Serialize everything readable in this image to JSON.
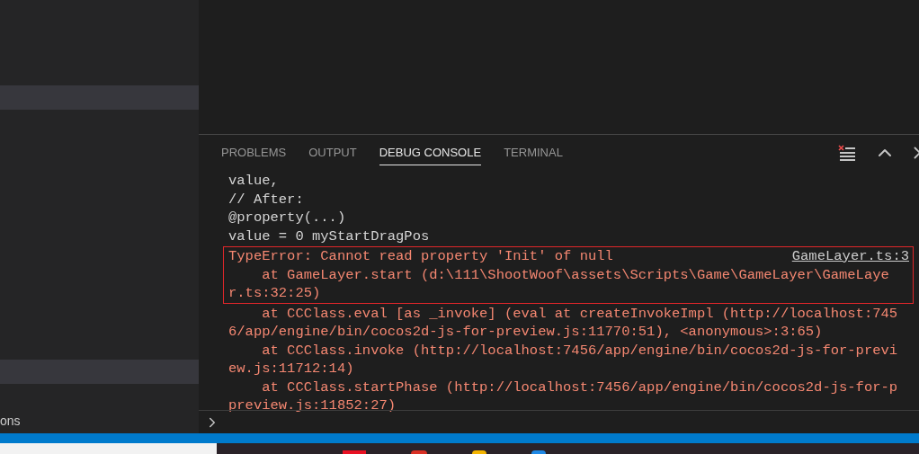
{
  "sidebar": {
    "items": [
      {
        "selected": true
      },
      {
        "selected": true
      },
      {
        "label": "ons",
        "selected": false
      }
    ]
  },
  "panel": {
    "tabs": [
      {
        "label": "PROBLEMS",
        "selected": false
      },
      {
        "label": "OUTPUT",
        "selected": false
      },
      {
        "label": "DEBUG CONSOLE",
        "selected": true
      },
      {
        "label": "TERMINAL",
        "selected": false
      }
    ],
    "console": {
      "blocks": [
        {
          "framed": false,
          "lines": [
            {
              "kind": "log",
              "text": "value,"
            },
            {
              "kind": "log",
              "text": "// After:"
            },
            {
              "kind": "log",
              "text": "@property(...)"
            },
            {
              "kind": "log",
              "text": "value = 0 myStartDragPos"
            }
          ]
        },
        {
          "framed": true,
          "lines": [
            {
              "kind": "error",
              "text": "TypeError: Cannot read property 'Init' of null",
              "link": "GameLayer.ts:3"
            },
            {
              "kind": "error",
              "text": "    at GameLayer.start (d:\\111\\ShootWoof\\assets\\Scripts\\Game\\GameLayer\\GameLaye"
            },
            {
              "kind": "error",
              "text": "r.ts:32:25)"
            }
          ]
        },
        {
          "framed": false,
          "lines": [
            {
              "kind": "error",
              "text": "    at CCClass.eval [as _invoke] (eval at createInvokeImpl (http://localhost:745"
            },
            {
              "kind": "error",
              "text": "6/app/engine/bin/cocos2d-js-for-preview.js:11770:51), <anonymous>:3:65)"
            },
            {
              "kind": "error",
              "text": "    at CCClass.invoke (http://localhost:7456/app/engine/bin/cocos2d-js-for-previ"
            },
            {
              "kind": "error",
              "text": "ew.js:11712:14)"
            },
            {
              "kind": "error",
              "text": "    at CCClass.startPhase (http://localhost:7456/app/engine/bin/cocos2d-js-for-p"
            },
            {
              "kind": "error",
              "text": "preview.js:11852:27)"
            }
          ]
        }
      ]
    }
  }
}
